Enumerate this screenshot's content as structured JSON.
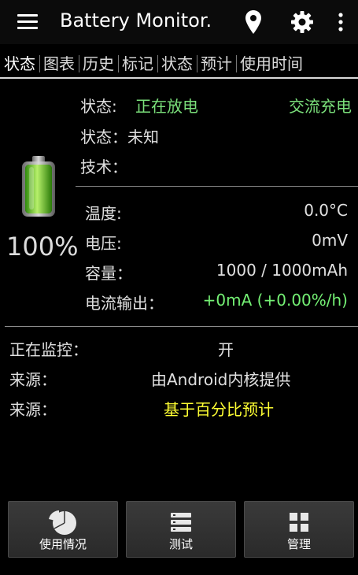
{
  "app": {
    "title": "Battery Monitor."
  },
  "icons": {
    "menu": "hamburger-icon",
    "location": "map-pin-icon",
    "settings": "gear-icon",
    "overflow": "vertical-dots-icon"
  },
  "tabs": [
    "状态",
    "图表",
    "历史",
    "标记",
    "状态",
    "预计",
    "使用时间"
  ],
  "battery": {
    "level_fraction": 1.0,
    "percent_text": "100%",
    "fill_color": "#55c81e"
  },
  "status": {
    "label": "状态:",
    "value": "正在放电",
    "charge_type": "交流充电",
    "health_line": "状态：未知",
    "tech_line": "技术："
  },
  "readings": [
    {
      "label": "温度:",
      "value": "0.0°C"
    },
    {
      "label": "电压:",
      "value": "0mV"
    },
    {
      "label": "容量：",
      "value": "1000 / 1000mAh"
    },
    {
      "label": "电流输出：",
      "value": "+0mA (+0.00%/h)"
    }
  ],
  "monitor": {
    "monitoring_label": "正在监控：",
    "monitoring_value": "开",
    "source1_label": "来源：",
    "source1_value": "由Android内核提供",
    "source2_label": "来源：",
    "source2_value": "基于百分比预计"
  },
  "buttons": [
    {
      "label": "使用情况",
      "icon": "pie-chart-icon"
    },
    {
      "label": "测试",
      "icon": "list-icon"
    },
    {
      "label": "管理",
      "icon": "grid-icon"
    }
  ],
  "colors": {
    "accent_green": "#7be07b",
    "estimate_yellow": "#ffff33"
  }
}
